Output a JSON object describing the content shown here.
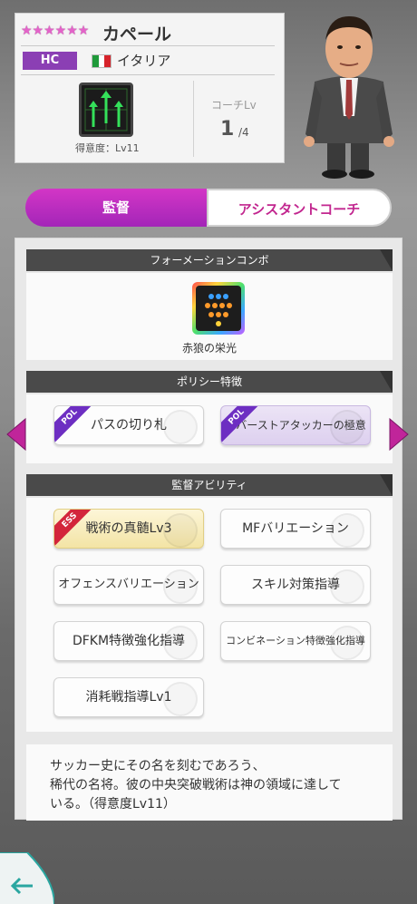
{
  "coach": {
    "name": "カペール",
    "stars": "★★★★★★",
    "role_badge": "HC",
    "nationality": "イタリア",
    "flag_colors": [
      "#1f9a3a",
      "#ffffff",
      "#d6232b"
    ],
    "proficiency_label": "得意度：Lv11",
    "coach_lv_label": "コーチLv",
    "coach_lv": "1",
    "coach_lv_max": "/4"
  },
  "tabs": {
    "active": "監督",
    "inactive": "アシスタントコーチ"
  },
  "sections": {
    "formation_combo": {
      "header": "フォーメーションコンボ",
      "label": "赤狼の栄光"
    },
    "policy": {
      "header": "ポリシー特徴",
      "items": [
        {
          "tag": "POL",
          "label": "パスの切り札"
        },
        {
          "tag": "POL",
          "label": "ロバーストアタッカーの極意"
        }
      ]
    },
    "abilities": {
      "header": "監督アビリティ",
      "items": [
        {
          "tag": "ESS",
          "label": "戦術の真髄Lv3"
        },
        {
          "tag": "",
          "label": "MFバリエーション"
        },
        {
          "tag": "",
          "label": "オフェンスバリエーション"
        },
        {
          "tag": "",
          "label": "スキル対策指導"
        },
        {
          "tag": "",
          "label": "DFKM特徴強化指導"
        },
        {
          "tag": "",
          "label": "コンビネーション特徴強化指導"
        },
        {
          "tag": "",
          "label": "消耗戦指導Lv1"
        }
      ]
    }
  },
  "description": {
    "line1": "サッカー史にその名を刻むであろう、",
    "line2": "稀代の名将。彼の中央突破戦術は神の領域に達して",
    "line3": "いる。（得意度Lv11）"
  },
  "colors": {
    "accent_magenta": "#c2268f",
    "badge_purple": "#8b3fb4"
  }
}
